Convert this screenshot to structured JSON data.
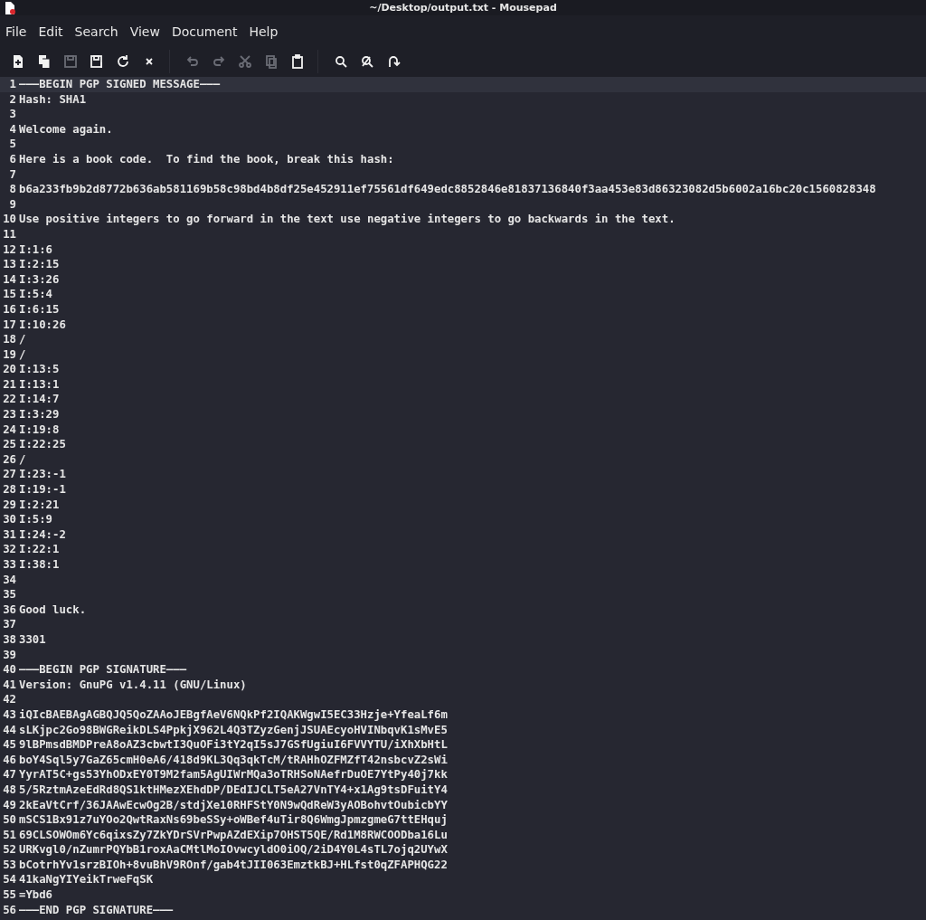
{
  "window": {
    "title": "~/Desktop/output.txt - Mousepad"
  },
  "menu": [
    "File",
    "Edit",
    "Search",
    "View",
    "Document",
    "Help"
  ],
  "toolbar": [
    {
      "kind": "new",
      "disabled": false
    },
    {
      "kind": "open",
      "disabled": false
    },
    {
      "kind": "save",
      "disabled": true
    },
    {
      "kind": "saveas",
      "disabled": false
    },
    {
      "kind": "reload",
      "disabled": false
    },
    {
      "kind": "close",
      "disabled": false
    },
    {
      "kind": "sep"
    },
    {
      "kind": "undo",
      "disabled": true
    },
    {
      "kind": "redo",
      "disabled": true
    },
    {
      "kind": "cut",
      "disabled": true
    },
    {
      "kind": "copy",
      "disabled": true
    },
    {
      "kind": "paste",
      "disabled": false
    },
    {
      "kind": "sep"
    },
    {
      "kind": "find",
      "disabled": false
    },
    {
      "kind": "replace",
      "disabled": false
    },
    {
      "kind": "goto",
      "disabled": false
    }
  ],
  "lines": [
    {
      "number": "1",
      "text": "———BEGIN PGP SIGNED MESSAGE———",
      "current": true
    },
    {
      "number": "2",
      "text": "Hash: SHA1",
      "current": false
    },
    {
      "number": "3",
      "current": false
    },
    {
      "number": "4",
      "text": "Welcome again.",
      "current": false
    },
    {
      "number": "5",
      "current": false
    },
    {
      "number": "6",
      "text": "Here is a book code.  To find the book, break this hash:",
      "current": false
    },
    {
      "number": "7",
      "current": false
    },
    {
      "number": "8",
      "text": "b6a233fb9b2d8772b636ab581169b58c98bd4b8df25e452911ef75561df649edc8852846e81837136840f3aa453e83d86323082d5b6002a16bc20c1560828348",
      "current": false
    },
    {
      "number": "9",
      "current": false
    },
    {
      "number": "10",
      "text": "Use positive integers to go forward in the text use negative integers to go backwards in the text.",
      "current": false
    },
    {
      "number": "11",
      "current": false
    },
    {
      "number": "12",
      "text": "I:1:6",
      "current": false
    },
    {
      "number": "13",
      "text": "I:2:15",
      "current": false
    },
    {
      "number": "14",
      "text": "I:3:26",
      "current": false
    },
    {
      "number": "15",
      "text": "I:5:4",
      "current": false
    },
    {
      "number": "16",
      "text": "I:6:15",
      "current": false
    },
    {
      "number": "17",
      "text": "I:10:26",
      "current": false
    },
    {
      "number": "18",
      "text": "/",
      "current": false
    },
    {
      "number": "19",
      "text": "/",
      "current": false
    },
    {
      "number": "20",
      "text": "I:13:5",
      "current": false
    },
    {
      "number": "21",
      "text": "I:13:1",
      "current": false
    },
    {
      "number": "22",
      "text": "I:14:7",
      "current": false
    },
    {
      "number": "23",
      "text": "I:3:29",
      "current": false
    },
    {
      "number": "24",
      "text": "I:19:8",
      "current": false
    },
    {
      "number": "25",
      "text": "I:22:25",
      "current": false
    },
    {
      "number": "26",
      "text": "/",
      "current": false
    },
    {
      "number": "27",
      "text": "I:23:-1",
      "current": false
    },
    {
      "number": "28",
      "text": "I:19:-1",
      "current": false
    },
    {
      "number": "29",
      "text": "I:2:21",
      "current": false
    },
    {
      "number": "30",
      "text": "I:5:9",
      "current": false
    },
    {
      "number": "31",
      "text": "I:24:-2",
      "current": false
    },
    {
      "number": "32",
      "text": "I:22:1",
      "current": false
    },
    {
      "number": "33",
      "text": "I:38:1",
      "current": false
    },
    {
      "number": "34",
      "current": false
    },
    {
      "number": "35",
      "current": false
    },
    {
      "number": "36",
      "text": "Good luck.",
      "current": false
    },
    {
      "number": "37",
      "current": false
    },
    {
      "number": "38",
      "text": "3301",
      "current": false
    },
    {
      "number": "39",
      "current": false
    },
    {
      "number": "40",
      "text": "———BEGIN PGP SIGNATURE———",
      "current": false
    },
    {
      "number": "41",
      "text": "Version: GnuPG v1.4.11 (GNU/Linux)",
      "current": false
    },
    {
      "number": "42",
      "current": false
    },
    {
      "number": "43",
      "text": "iQIcBAEBAgAGBQJQ5QoZAAoJEBgfAeV6NQkPf2IQAKWgwI5EC33Hzje+YfeaLf6m",
      "current": false
    },
    {
      "number": "44",
      "text": "sLKjpc2Go98BWGReikDLS4PpkjX962L4Q3TZyzGenjJSUAEcyoHVINbqvK1sMvE5",
      "current": false
    },
    {
      "number": "45",
      "text": "9lBPmsdBMDPreA8oAZ3cbwtI3QuOFi3tY2qI5sJ7GSfUgiuI6FVVYTU/iXhXbHtL",
      "current": false
    },
    {
      "number": "46",
      "text": "boY4Sql5y7GaZ65cmH0eA6/418d9KL3Qq3qkTcM/tRAHhOZFMZfT42nsbcvZ2sWi",
      "current": false
    },
    {
      "number": "47",
      "text": "YyrAT5C+gs53YhODxEY0T9M2fam5AgUIWrMQa3oTRHSoNAefrDuOE7YtPy40j7kk",
      "current": false
    },
    {
      "number": "48",
      "text": "5/5RztmAzeEdRd8QS1ktHMezXEhdDP/DEdIJCLT5eA27VnTY4+x1Ag9tsDFuitY4",
      "current": false
    },
    {
      "number": "49",
      "text": "2kEaVtCrf/36JAAwEcwOg2B/stdjXe10RHFStY0N9wQdReW3yAOBohvtOubicbYY",
      "current": false
    },
    {
      "number": "50",
      "text": "mSCS1Bx91z7uYOo2QwtRaxNs69beSSy+oWBef4uTir8Q6WmgJpmzgmeG7ttEHquj",
      "current": false
    },
    {
      "number": "51",
      "text": "69CLSOWOm6Yc6qixsZy7ZkYDrSVrPwpAZdEXip7OHST5QE/Rd1M8RWCOODba16Lu",
      "current": false
    },
    {
      "number": "52",
      "text": "URKvgl0/nZumrPQYbB1roxAaCMtlMoIOvwcyldO0iOQ/2iD4Y0L4sTL7ojq2UYwX",
      "current": false
    },
    {
      "number": "53",
      "text": "bCotrhYv1srzBIOh+8vuBhV9ROnf/gab4tJII063EmztkBJ+HLfst0qZFAPHQG22",
      "current": false
    },
    {
      "number": "54",
      "text": "41kaNgYIYeikTrweFqSK",
      "current": false
    },
    {
      "number": "55",
      "text": "=Ybd6",
      "current": false
    },
    {
      "number": "56",
      "text": "———END PGP SIGNATURE———",
      "current": false
    }
  ]
}
